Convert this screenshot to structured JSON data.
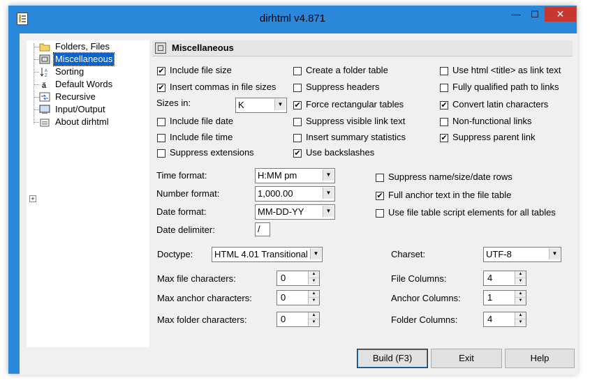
{
  "window": {
    "title": "dirhtml v4.871",
    "minimize": "—",
    "maximize": "☐",
    "close": "✕"
  },
  "tree": {
    "items": [
      {
        "label": "Folders, Files",
        "icon": "folder-icon"
      },
      {
        "label": "Miscellaneous",
        "icon": "panel-icon"
      },
      {
        "label": "Sorting",
        "icon": "sort-icon"
      },
      {
        "label": "Default Words",
        "icon": "words-icon"
      },
      {
        "label": "Recursive",
        "icon": "recursive-icon"
      },
      {
        "label": "Input/Output",
        "icon": "io-icon"
      },
      {
        "label": "About dirhtml",
        "icon": "html-icon"
      }
    ],
    "selected": "Miscellaneous",
    "expander": "+"
  },
  "panel": {
    "title": "Miscellaneous"
  },
  "col1": {
    "include_file_size": {
      "label": "Include file size",
      "checked": true
    },
    "insert_commas": {
      "label": "Insert commas in file sizes",
      "checked": true
    },
    "sizes_in_label": "Sizes in:",
    "sizes_in_value": "K",
    "include_file_date": {
      "label": "Include file date",
      "checked": false
    },
    "include_file_time": {
      "label": "Include file time",
      "checked": false
    },
    "suppress_extensions": {
      "label": "Suppress extensions",
      "checked": false
    }
  },
  "col2": {
    "create_folder_table": {
      "label": "Create a folder table",
      "checked": false
    },
    "suppress_headers": {
      "label": "Suppress headers",
      "checked": false
    },
    "force_rect_tables": {
      "label": "Force rectangular tables",
      "checked": true
    },
    "suppress_visible_link": {
      "label": "Suppress visible link text",
      "checked": false
    },
    "insert_summary": {
      "label": "Insert summary statistics",
      "checked": false
    },
    "use_backslashes": {
      "label": "Use backslashes",
      "checked": true
    }
  },
  "col3": {
    "use_html_title": {
      "label": "Use html <title> as link text",
      "checked": false
    },
    "fully_qualified": {
      "label": "Fully qualified path to links",
      "checked": false
    },
    "convert_latin": {
      "label": "Convert latin characters",
      "checked": true
    },
    "non_functional": {
      "label": "Non-functional links",
      "checked": false
    },
    "suppress_parent": {
      "label": "Suppress parent link",
      "checked": true
    }
  },
  "formats": {
    "time_label": "Time format:",
    "time_value": "H:MM pm",
    "number_label": "Number format:",
    "number_value": "1,000.00",
    "date_label": "Date format:",
    "date_value": "MM-DD-YY",
    "delim_label": "Date delimiter:",
    "delim_value": "/"
  },
  "rows_opts": {
    "suppress_nsd": {
      "label": "Suppress name/size/date rows",
      "checked": false
    },
    "full_anchor": {
      "label": "Full anchor text in the file table",
      "checked": true
    },
    "use_script": {
      "label": "Use file table script elements for all tables",
      "checked": false
    }
  },
  "doctype": {
    "label": "Doctype:",
    "value": "HTML 4.01 Transitional"
  },
  "charset": {
    "label": "Charset:",
    "value": "UTF-8"
  },
  "limits": {
    "max_file_label": "Max file characters:",
    "max_file": "0",
    "max_anchor_label": "Max anchor characters:",
    "max_anchor": "0",
    "max_folder_label": "Max folder characters:",
    "max_folder": "0"
  },
  "columns": {
    "file_label": "File Columns:",
    "file": "4",
    "anchor_label": "Anchor Columns:",
    "anchor": "1",
    "folder_label": "Folder Columns:",
    "folder": "4"
  },
  "buttons": {
    "build": "Build (F3)",
    "exit": "Exit",
    "help": "Help"
  }
}
